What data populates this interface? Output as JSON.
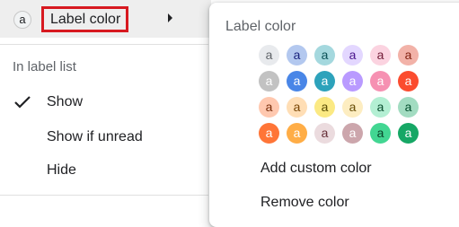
{
  "menu": {
    "top_item": {
      "badge_letter": "a",
      "label": "Label color"
    },
    "section_heading": "In label list",
    "items": [
      {
        "label": "Show",
        "checked": true
      },
      {
        "label": "Show if unread",
        "checked": false
      },
      {
        "label": "Hide",
        "checked": false
      }
    ]
  },
  "colors": {
    "highlight_border": "#d71920",
    "hover_background": "#eeeeee"
  },
  "popup": {
    "title": "Label color",
    "swatches": [
      [
        {
          "bg": "#e8eaed",
          "fg": "#5f6368",
          "letter": "a"
        },
        {
          "bg": "#b3c8ef",
          "fg": "#1a237e",
          "letter": "a"
        },
        {
          "bg": "#a4d8de",
          "fg": "#0b5257",
          "letter": "a"
        },
        {
          "bg": "#e3d7ff",
          "fg": "#4a148c",
          "letter": "a"
        },
        {
          "bg": "#fbd3e0",
          "fg": "#711a36",
          "letter": "a"
        },
        {
          "bg": "#f2b2a8",
          "fg": "#822111",
          "letter": "a"
        }
      ],
      [
        {
          "bg": "#c2c2c2",
          "fg": "#ffffff",
          "letter": "a"
        },
        {
          "bg": "#4986e7",
          "fg": "#ffffff",
          "letter": "a"
        },
        {
          "bg": "#2da2bb",
          "fg": "#ffffff",
          "letter": "a"
        },
        {
          "bg": "#b99aff",
          "fg": "#ffffff",
          "letter": "a"
        },
        {
          "bg": "#f691b2",
          "fg": "#ffffff",
          "letter": "a"
        },
        {
          "bg": "#fb4c2f",
          "fg": "#ffffff",
          "letter": "a"
        }
      ],
      [
        {
          "bg": "#ffc8af",
          "fg": "#7a2e0b",
          "letter": "a"
        },
        {
          "bg": "#ffdeb5",
          "fg": "#7a4706",
          "letter": "a"
        },
        {
          "bg": "#fbe983",
          "fg": "#594c05",
          "letter": "a"
        },
        {
          "bg": "#fdedc1",
          "fg": "#684e07",
          "letter": "a"
        },
        {
          "bg": "#b3efd3",
          "fg": "#0b4f30",
          "letter": "a"
        },
        {
          "bg": "#a2dcc1",
          "fg": "#04502e",
          "letter": "a"
        }
      ],
      [
        {
          "bg": "#ff7537",
          "fg": "#ffffff",
          "letter": "a"
        },
        {
          "bg": "#ffad46",
          "fg": "#ffffff",
          "letter": "a"
        },
        {
          "bg": "#ebdbde",
          "fg": "#662e37",
          "letter": "a"
        },
        {
          "bg": "#cca6ac",
          "fg": "#ffffff",
          "letter": "a"
        },
        {
          "bg": "#42d692",
          "fg": "#094228",
          "letter": "a"
        },
        {
          "bg": "#16a765",
          "fg": "#ffffff",
          "letter": "a"
        }
      ]
    ],
    "add_custom_color": "Add custom color",
    "remove_color": "Remove color"
  }
}
